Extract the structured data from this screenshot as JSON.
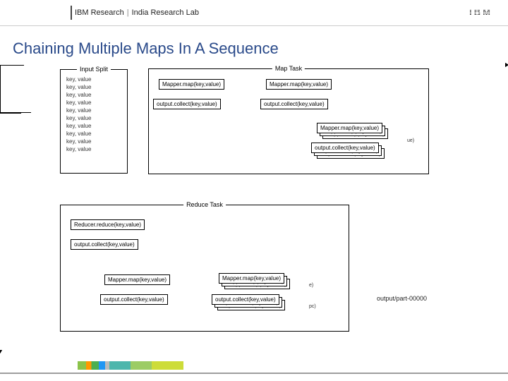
{
  "header": {
    "org": "IBM Research",
    "sep": "|",
    "lab": "India Research Lab",
    "logo": "IBM"
  },
  "title": "Chaining Multiple Maps In A Sequence",
  "input_split": {
    "label": "Input Split",
    "rows": [
      "key, value",
      "key, value",
      "key, value",
      "key, value",
      "key, value",
      "key, value",
      "key, value",
      "key, value",
      "key, value",
      "key, value"
    ]
  },
  "map_task": {
    "label": "Map Task",
    "mapper1": {
      "map": "Mapper.map(key,value)",
      "collect": "output.collect(key,value)"
    },
    "mapper2": {
      "map": "Mapper.map(key,value)",
      "collect": "output.collect(key,value)"
    },
    "stacked": {
      "map": "Mapper.map(key,value)",
      "collect": "output.collect(key,value)",
      "edge": "ue)"
    }
  },
  "reduce_task": {
    "label": "Reduce Task",
    "reducer": {
      "reduce": "Reducer.reduce(key,value)",
      "collect": "output.collect(key,value)"
    },
    "mapper1": {
      "map": "Mapper.map(key,value)",
      "collect": "output.collect(key,value)"
    },
    "stacked": {
      "map": "Mapper.map(key,value)",
      "collect": "output.collect(key,value)",
      "edge_e": "e)",
      "edge_pc": "pc)"
    }
  },
  "output": "output/part-00000"
}
